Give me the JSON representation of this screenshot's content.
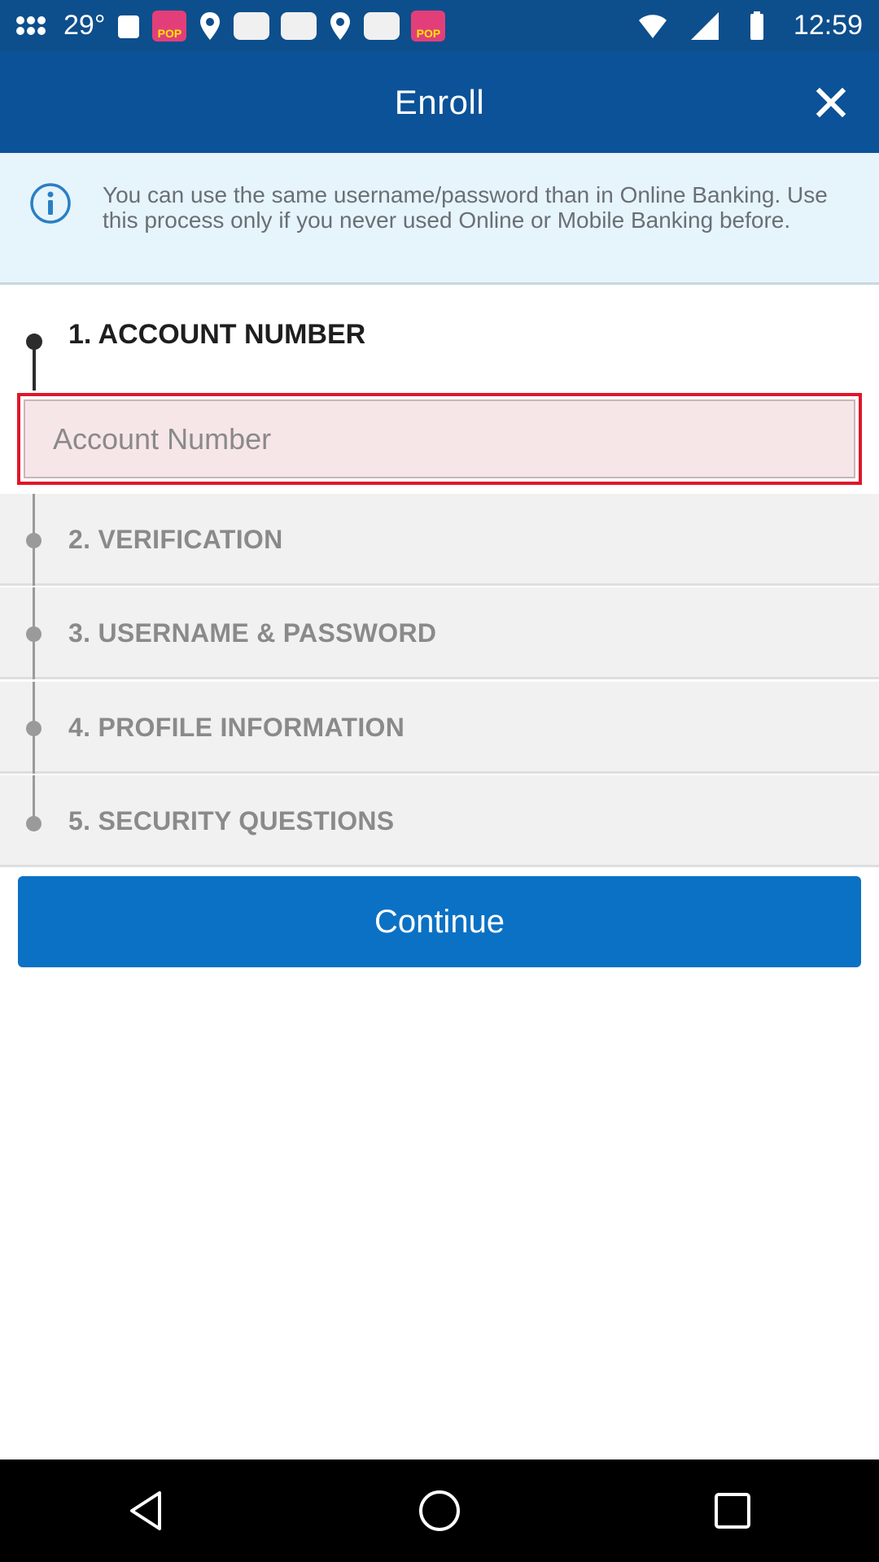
{
  "status_bar": {
    "temperature": "29°",
    "time": "12:59",
    "icons": [
      "apps-icon",
      "temperature",
      "gallery-icon",
      "pop-app-icon",
      "location-icon",
      "gallery-icon",
      "gallery-icon",
      "location-icon",
      "gallery-icon",
      "pop-app-icon",
      "wifi-icon",
      "signal-icon",
      "battery-icon"
    ],
    "pop_badge": "POP"
  },
  "header": {
    "title": "Enroll",
    "close_icon": "close-icon",
    "bg_color": "#0b5298"
  },
  "info_banner": {
    "icon": "info-icon",
    "text": "You can use the same username/password than in Online Banking. Use this process only if you never used Online or Mobile Banking before."
  },
  "steps": [
    {
      "label": "1. ACCOUNT NUMBER",
      "active": true
    },
    {
      "label": "2. VERIFICATION",
      "active": false
    },
    {
      "label": "3. USERNAME & PASSWORD",
      "active": false
    },
    {
      "label": "4. PROFILE INFORMATION",
      "active": false
    },
    {
      "label": "5. SECURITY QUESTIONS",
      "active": false
    }
  ],
  "account_field": {
    "placeholder": "Account Number",
    "value": "",
    "error_color": "#e0162b"
  },
  "continue_button": {
    "label": "Continue",
    "color": "#0b71c4"
  },
  "nav_bar": {
    "buttons": [
      "back-icon",
      "home-icon",
      "recents-icon"
    ]
  }
}
